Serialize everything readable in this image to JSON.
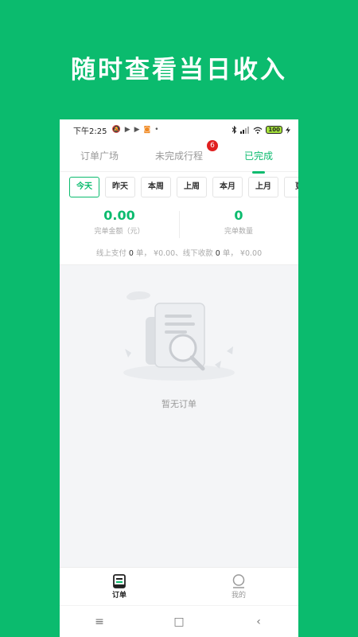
{
  "headline": "随时查看当日收入",
  "status_bar": {
    "time": "下午2:25",
    "battery": "100"
  },
  "tabs": [
    {
      "label": "订单广场"
    },
    {
      "label": "未完成行程",
      "badge": "6"
    },
    {
      "label": "已完成"
    }
  ],
  "filters": [
    "今天",
    "昨天",
    "本周",
    "上周",
    "本月",
    "上月",
    "更"
  ],
  "active_filter": "今天",
  "stats": {
    "amount_value": "0.00",
    "amount_label": "完单金额（元）",
    "count_value": "0",
    "count_label": "完单数量"
  },
  "payment_summary": {
    "online_label": "线上支付",
    "online_count": "0",
    "unit": "单，",
    "online_amount": "¥0.00",
    "offline_label": "线下收款",
    "offline_count": "0",
    "offline_amount": "¥0.00"
  },
  "empty_state": {
    "text": "暂无订单"
  },
  "bottom_nav": [
    {
      "label": "订单",
      "icon": "order-doc-icon",
      "active": true
    },
    {
      "label": "我的",
      "icon": "user-profile-icon",
      "active": false
    }
  ],
  "system_nav": {
    "menu_glyph": "≡",
    "home_glyph": "□",
    "back_glyph": "‹"
  },
  "colors": {
    "brand_green": "#0bbb6e",
    "badge_red": "#e02020"
  }
}
